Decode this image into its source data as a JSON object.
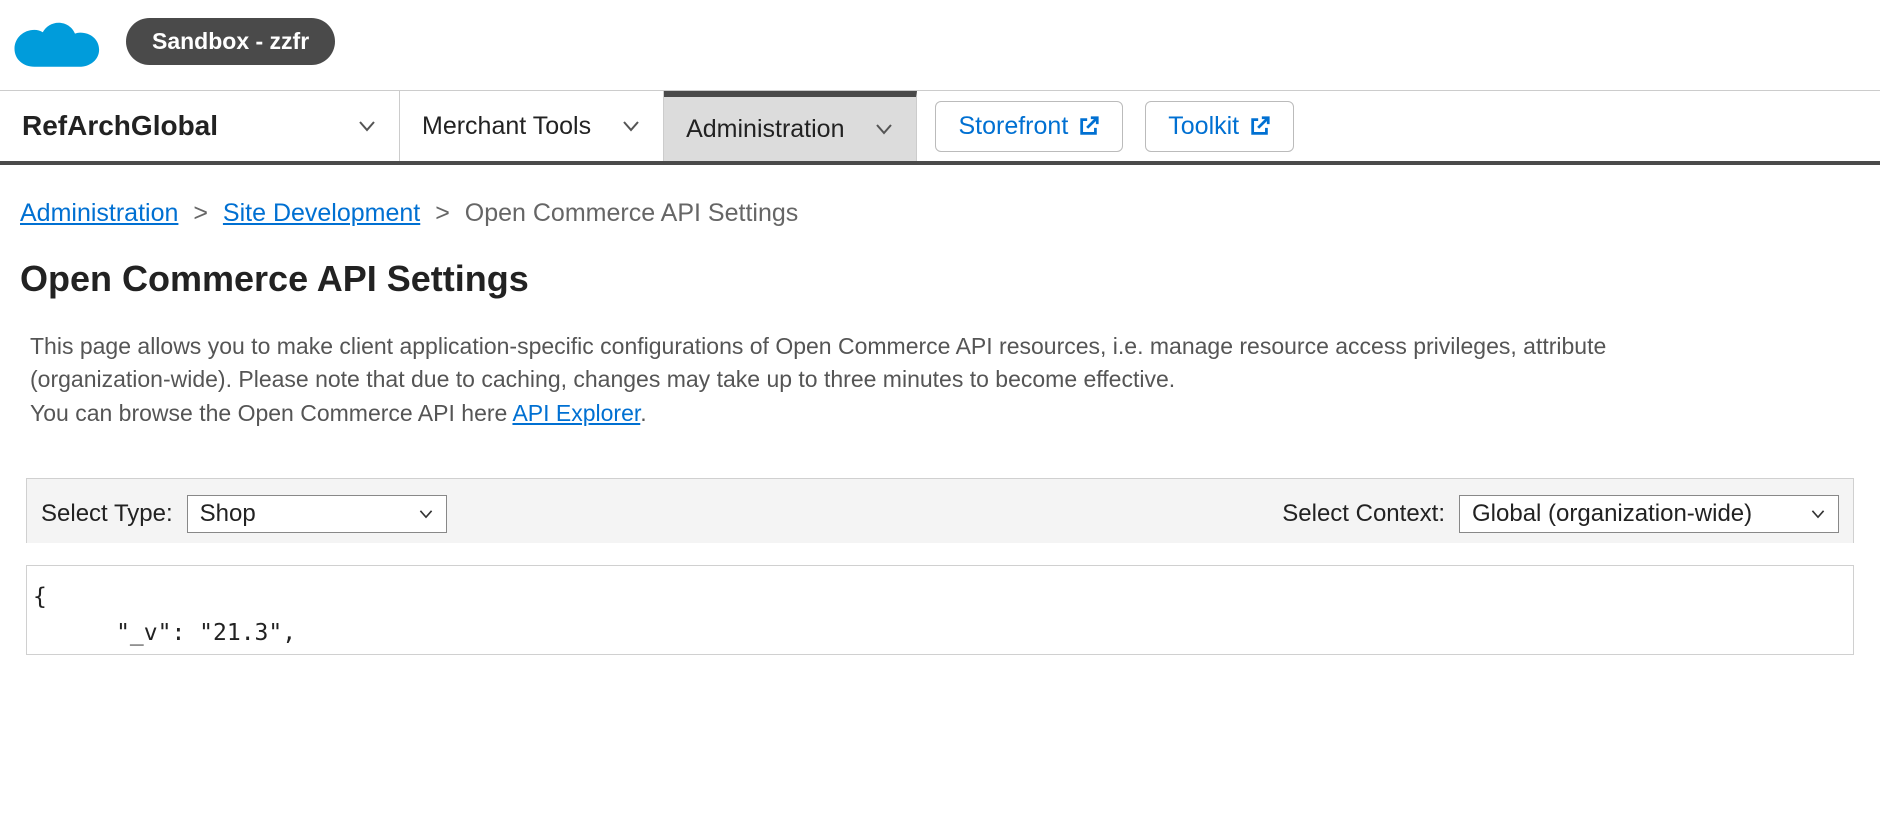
{
  "header": {
    "sandbox_label": "Sandbox - zzfr"
  },
  "menubar": {
    "site": "RefArchGlobal",
    "merchant_tools": "Merchant Tools",
    "administration": "Administration",
    "storefront": "Storefront",
    "toolkit": "Toolkit"
  },
  "breadcrumb": {
    "administration": "Administration",
    "site_development": "Site Development",
    "current": "Open Commerce API Settings"
  },
  "page_title": "Open Commerce API Settings",
  "description": {
    "line1": "This page allows you to make client application-specific configurations of Open Commerce API resources, i.e. manage resource access privileges, attribute",
    "line2a": "(organization-wide). Please note that due to caching, changes may take up to three minutes to become effective.",
    "line2b": "You can browse the Open Commerce API here ",
    "api_explorer": "API Explorer",
    "period": "."
  },
  "controls": {
    "select_type_label": "Select Type:",
    "select_type_value": "Shop",
    "select_context_label": "Select Context:",
    "select_context_value": "Global (organization-wide)"
  },
  "code": "{\n      \"_v\": \"21.3\","
}
